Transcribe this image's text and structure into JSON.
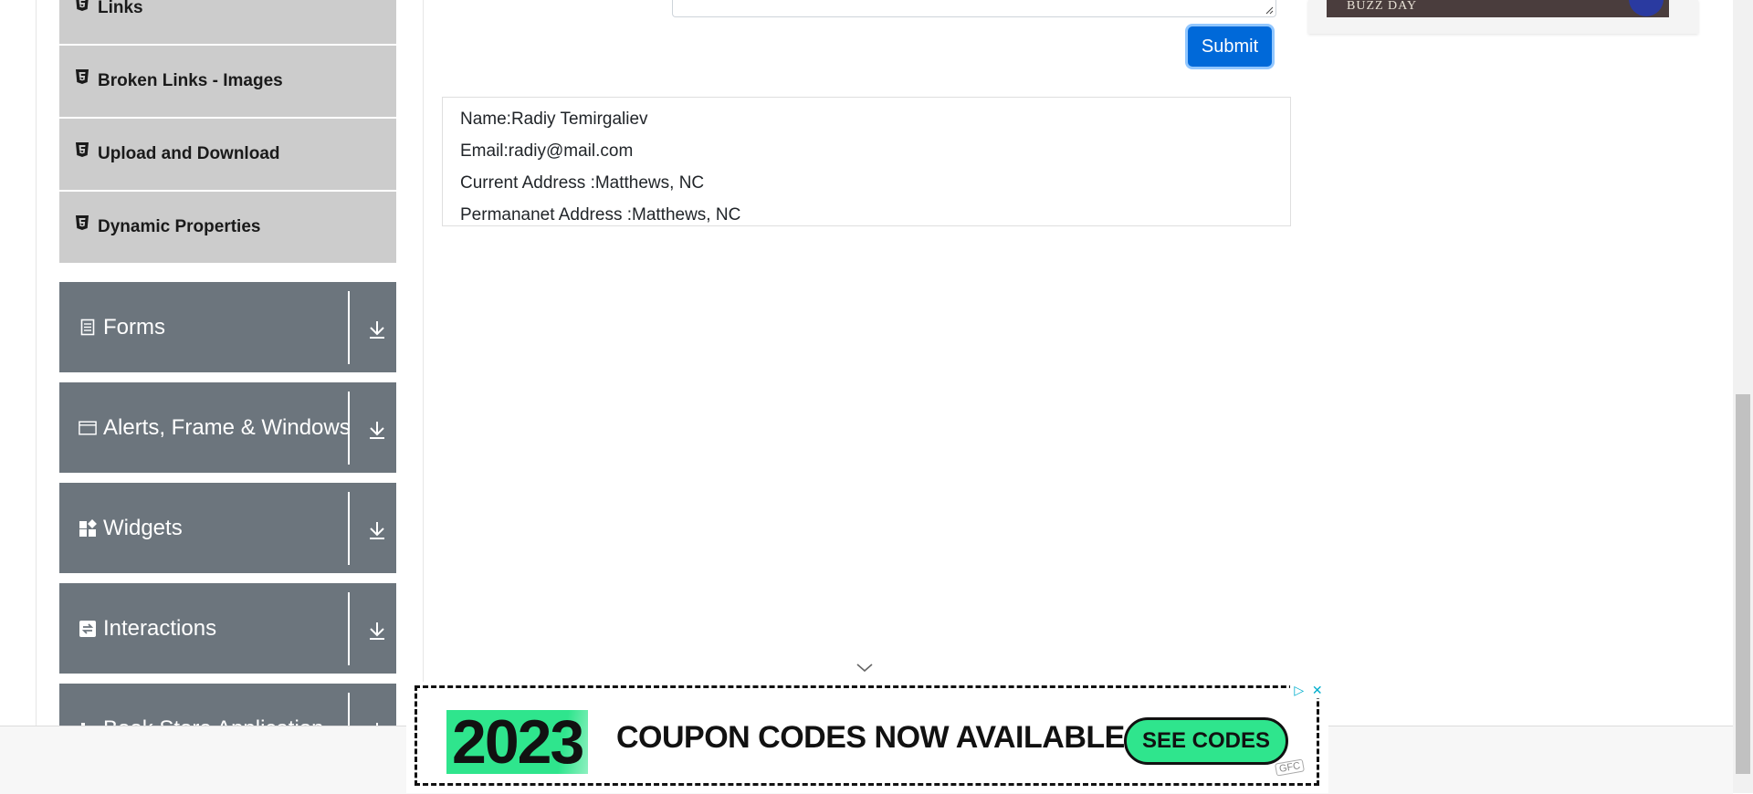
{
  "sidebar": {
    "elements_items": [
      {
        "label": "Links",
        "icon": "html5-icon"
      },
      {
        "label": "Broken Links - Images",
        "icon": "html5-icon"
      },
      {
        "label": "Upload and Download",
        "icon": "html5-icon"
      },
      {
        "label": "Dynamic Properties",
        "icon": "html5-icon"
      }
    ],
    "groups": [
      {
        "label": "Forms",
        "icon": "form-icon"
      },
      {
        "label": "Alerts, Frame & Windows",
        "icon": "window-icon"
      },
      {
        "label": "Widgets",
        "icon": "widgets-icon"
      },
      {
        "label": "Interactions",
        "icon": "interactions-icon"
      },
      {
        "label": "Book Store Application",
        "icon": "book-icon"
      }
    ]
  },
  "form": {
    "submit_label": "Submit"
  },
  "output": {
    "name": "Name:Radiy Temirgaliev",
    "email": "Email:radiy@mail.com",
    "current_address": "Current Address :Matthews, NC",
    "permanent_address": "Permananet Address :Matthews, NC"
  },
  "ads": {
    "top_ad_text": "BUZZ DAY",
    "bottom_ad": {
      "year": "2023",
      "headline": "COUPON CODES NOW AVAILABLE",
      "cta": "SEE CODES",
      "badge": "GFC"
    }
  },
  "colors": {
    "sidebar_group_bg": "#6c757d",
    "sidebar_item_bg": "#cccccc",
    "submit_bg": "#0069d9",
    "ad_green": "#2fe58d"
  }
}
